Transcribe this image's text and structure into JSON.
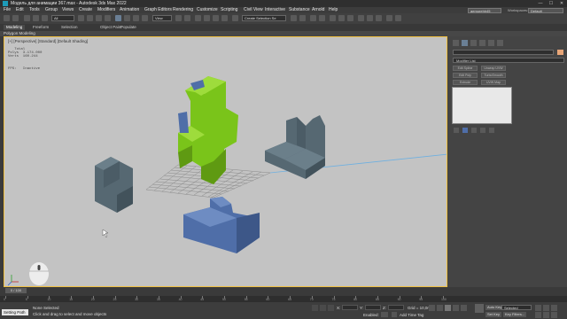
{
  "window": {
    "title": "Модель для анимации 367.max - Autodesk 3ds Max 2022",
    "minimize": "—",
    "maximize": "☐",
    "close": "✕"
  },
  "menubar": {
    "items": [
      "File",
      "Edit",
      "Tools",
      "Group",
      "Views",
      "Create",
      "Modifiers",
      "Animation",
      "Graph Editors",
      "Rendering",
      "Customize",
      "Scripting",
      "Civil View",
      "Interactive",
      "Substance",
      "Arnold",
      "Help"
    ],
    "sign_in": "aemurehh45",
    "workspaces_label": "Workspaces:",
    "workspace_value": "Default"
  },
  "toolbar": {
    "selection_filter": "All",
    "ref_coord": "View",
    "named_selection": "Create Selection Se"
  },
  "ribbon": {
    "tabs": [
      "Modeling",
      "Freeform",
      "Selection",
      "Object Paint",
      "Populate"
    ],
    "panel_label": "Polygon Modeling"
  },
  "viewport": {
    "label": "[+] [Perspective] [Standard] [Default Shading]",
    "stats": "   Total\nPolys  3.174.000\nVerts  160.244",
    "fps": "FPS:   Inactive"
  },
  "command_panel": {
    "modifier_list": "Modifier List",
    "buttons": [
      "Edit Spline",
      "Unwrap UVW",
      "Edit Poly",
      "TurboSmooth",
      "Extrude",
      "UVW Map"
    ]
  },
  "timeline": {
    "slider": "0 / 100",
    "ticks": [
      "0",
      "5",
      "10",
      "15",
      "20",
      "25",
      "30",
      "35",
      "40",
      "45",
      "50",
      "55",
      "60",
      "65",
      "70",
      "75",
      "80",
      "85",
      "90",
      "95",
      "100"
    ]
  },
  "statusbar": {
    "script_label": "Setting Path",
    "status_line": "None Selected",
    "prompt_line": "Click and drag to select and move objects",
    "x_label": "X:",
    "y_label": "Y:",
    "z_label": "Z:",
    "grid": "Grid = 10,0mm",
    "enabled": "Enabled:",
    "add_time_tag": "Add Time Tag",
    "auto_key": "Auto Key",
    "set_key": "Set Key",
    "selected": "Selected",
    "key_filters": "Key Filters..."
  },
  "colors": {
    "green_object": "#7ac41a",
    "blue_object": "#4f6ea8",
    "gray_object": "#566872",
    "viewport_bg": "#c3c3c3",
    "active_border": "#f0c040"
  }
}
